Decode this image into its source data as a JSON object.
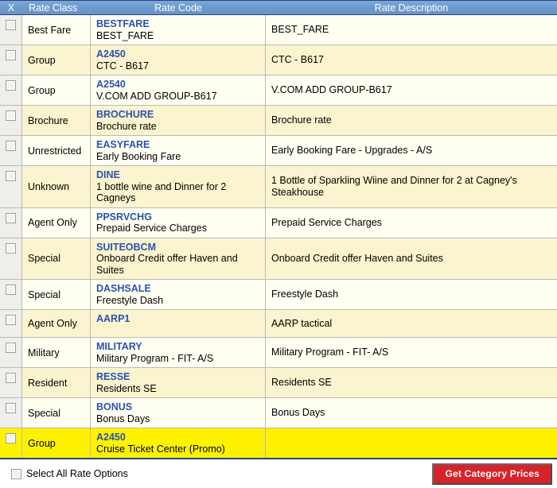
{
  "grid": {
    "columns": {
      "checkbox": "X",
      "rate_class": "Rate Class",
      "rate_code": "Rate Code",
      "rate_description": "Rate Description"
    },
    "rows": [
      {
        "rate_class": "Best Fare",
        "rate_code": "BESTFARE",
        "rate_code_name": "BEST_FARE",
        "rate_description": "BEST_FARE",
        "checked": false,
        "highlighted": false
      },
      {
        "rate_class": "Group",
        "rate_code": "A2450",
        "rate_code_name": "CTC - B617",
        "rate_description": "CTC - B617",
        "checked": false,
        "highlighted": false
      },
      {
        "rate_class": "Group",
        "rate_code": "A2540",
        "rate_code_name": "V.COM ADD GROUP-B617",
        "rate_description": "V.COM ADD GROUP-B617",
        "checked": false,
        "highlighted": false
      },
      {
        "rate_class": "Brochure",
        "rate_code": "BROCHURE",
        "rate_code_name": "Brochure rate",
        "rate_description": "Brochure rate",
        "checked": false,
        "highlighted": false
      },
      {
        "rate_class": "Unrestricted",
        "rate_code": "EASYFARE",
        "rate_code_name": "Early Booking Fare",
        "rate_description": "Early Booking Fare - Upgrades - A/S",
        "checked": false,
        "highlighted": false
      },
      {
        "rate_class": "Unknown",
        "rate_code": "DINE",
        "rate_code_name": "1 bottle wine and Dinner for 2 Cagneys",
        "rate_description": "1 Bottle of Sparkling Wiine and Dinner for 2 at Cagney's Steakhouse",
        "checked": false,
        "highlighted": false
      },
      {
        "rate_class": "Agent Only",
        "rate_code": "PPSRVCHG",
        "rate_code_name": "Prepaid Service Charges",
        "rate_description": "Prepaid Service Charges",
        "checked": false,
        "highlighted": false
      },
      {
        "rate_class": "Special",
        "rate_code": "SUITEOBCM",
        "rate_code_name": "Onboard Credit offer Haven and Suites",
        "rate_description": "Onboard Credit offer Haven and Suites",
        "checked": false,
        "highlighted": false
      },
      {
        "rate_class": "Special",
        "rate_code": "DASHSALE",
        "rate_code_name": "Freestyle Dash",
        "rate_description": "Freestyle Dash",
        "checked": false,
        "highlighted": false
      },
      {
        "rate_class": "Agent Only",
        "rate_code": "AARP1",
        "rate_code_name": "",
        "rate_description": "AARP tactical",
        "checked": false,
        "highlighted": false
      },
      {
        "rate_class": "Military",
        "rate_code": "MILITARY",
        "rate_code_name": "Military Program - FIT- A/S",
        "rate_description": "Military Program - FIT- A/S",
        "checked": false,
        "highlighted": false
      },
      {
        "rate_class": "Resident",
        "rate_code": "RESSE",
        "rate_code_name": "Residents SE",
        "rate_description": "Residents SE",
        "checked": false,
        "highlighted": false
      },
      {
        "rate_class": "Special",
        "rate_code": "BONUS",
        "rate_code_name": "Bonus Days",
        "rate_description": "Bonus Days",
        "checked": false,
        "highlighted": false
      },
      {
        "rate_class": "Group",
        "rate_code": "A2450",
        "rate_code_name": "Cruise Ticket Center (Promo)",
        "rate_description": "",
        "checked": false,
        "highlighted": true
      }
    ]
  },
  "footer": {
    "select_all_label": "Select All Rate Options",
    "select_all_checked": false,
    "get_prices_label": "Get Category Prices"
  },
  "colors": {
    "header_bar": "#6c9acd",
    "header_border": "#2b3f86",
    "row_odd": "#fffff2",
    "row_even": "#faf4cf",
    "row_highlight": "#fff200",
    "code_link": "#2b52b0",
    "button_red": "#d8232a",
    "grid_line": "#b9b9b9"
  }
}
